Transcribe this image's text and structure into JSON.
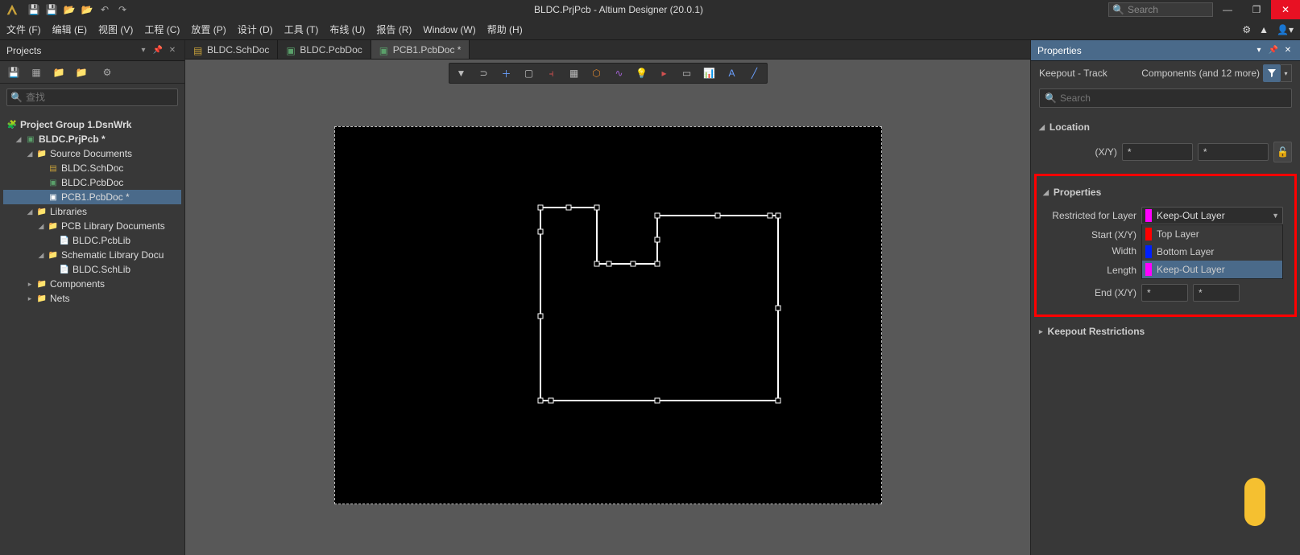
{
  "app": {
    "title": "BLDC.PrjPcb - Altium Designer (20.0.1)",
    "search_placeholder": "Search"
  },
  "menu": {
    "file": "文件 (F)",
    "edit": "编辑 (E)",
    "view": "视图 (V)",
    "project": "工程 (C)",
    "place": "放置 (P)",
    "design": "设计 (D)",
    "tools": "工具 (T)",
    "route": "布线 (U)",
    "reports": "报告 (R)",
    "window": "Window (W)",
    "help": "帮助 (H)"
  },
  "projects": {
    "title": "Projects",
    "search_placeholder": "查找",
    "tree": {
      "group": "Project Group 1.DsnWrk",
      "prj": "BLDC.PrjPcb *",
      "src_folder": "Source Documents",
      "schdoc": "BLDC.SchDoc",
      "pcbdoc": "BLDC.PcbDoc",
      "pcb1": "PCB1.PcbDoc *",
      "libraries": "Libraries",
      "pcblibdocs": "PCB Library Documents",
      "pcblib": "BLDC.PcbLib",
      "schlibdocs": "Schematic Library Docu",
      "schlib": "BLDC.SchLib",
      "components": "Components",
      "nets": "Nets"
    }
  },
  "tabs": {
    "t1": "BLDC.SchDoc",
    "t2": "BLDC.PcbDoc",
    "t3": "PCB1.PcbDoc *"
  },
  "properties": {
    "title": "Properties",
    "object": "Keepout - Track",
    "scope": "Components (and 12 more)",
    "search_placeholder": "Search",
    "section_location": "Location",
    "xy_label": "(X/Y)",
    "x_val": "*",
    "y_val": "*",
    "section_properties": "Properties",
    "restricted_label": "Restricted for Layer",
    "layer_selected": "Keep-Out Layer",
    "layer_opts": {
      "top": {
        "name": "Top Layer",
        "color": "#ff0000"
      },
      "bot": {
        "name": "Bottom Layer",
        "color": "#0020ff"
      },
      "keep": {
        "name": "Keep-Out Layer",
        "color": "#ff00ff"
      }
    },
    "startxy_label": "Start (X/Y)",
    "width_label": "Width",
    "length_label": "Length",
    "length_val": "*",
    "endxy_label": "End (X/Y)",
    "endx_val": "*",
    "endy_val": "*",
    "section_keepout": "Keepout Restrictions"
  }
}
